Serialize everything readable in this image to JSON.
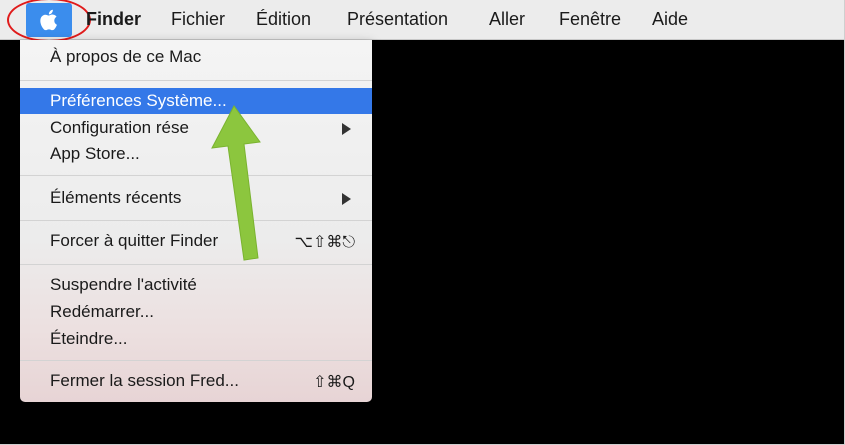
{
  "menubar": {
    "apple_icon": "apple-logo-icon",
    "items": [
      "Finder",
      "Fichier",
      "Édition",
      "Présentation",
      "Aller",
      "Fenêtre",
      "Aide"
    ]
  },
  "apple_menu": {
    "about": "À propos de ce Mac",
    "system_prefs": "Préférences Système...",
    "network_config": "Configuration rése",
    "app_store": "App Store...",
    "recent_items": "Éléments récents",
    "force_quit": "Forcer à quitter Finder",
    "force_quit_shortcut": "⌥⇧⌘⎋",
    "sleep": "Suspendre l'activité",
    "restart": "Redémarrer...",
    "shutdown": "Éteindre...",
    "logout": "Fermer la session Fred...",
    "logout_shortcut": "⇧⌘Q"
  },
  "annotations": {
    "highlight_color": "#e01b1b",
    "arrow_color": "#8cc63e",
    "selection_color": "#3478e8"
  }
}
